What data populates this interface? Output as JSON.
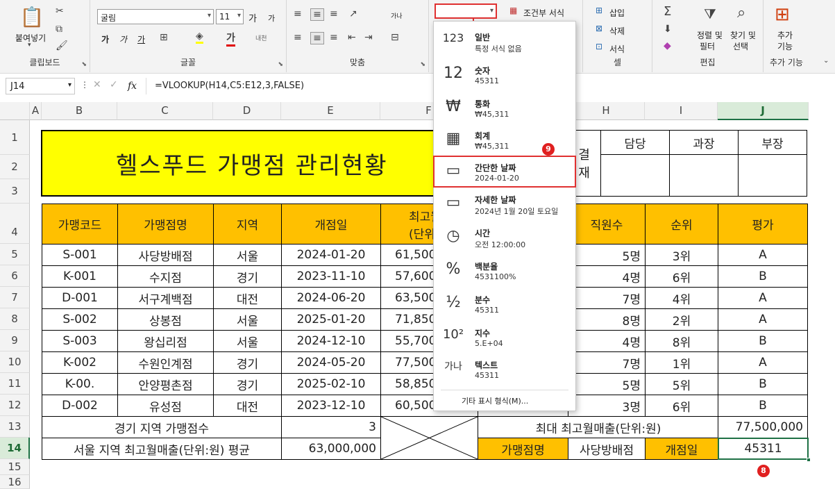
{
  "ribbon": {
    "clipboard": {
      "paste": "붙여넣기",
      "label": "클립보드"
    },
    "font": {
      "name": "굴림",
      "size": "11",
      "grow": "가",
      "shrink": "가",
      "bold": "가",
      "italic": "가",
      "underline": "가",
      "label": "글꼴",
      "phonetic": "내천"
    },
    "align": {
      "label": "맞춤",
      "wrap": "가나"
    },
    "number": {
      "format_value": "",
      "cond_format": "조건부 서식"
    },
    "cells": {
      "insert": "삽입",
      "delete": "삭제",
      "format": "서식",
      "label": "셀"
    },
    "editing": {
      "sort": "정렬 및",
      "sort2": "필터",
      "find": "찾기 및",
      "find2": "선택",
      "label": "편집"
    },
    "addins": {
      "label1": "추가",
      "label2": "기능",
      "group": "추가 기능"
    }
  },
  "formula_bar": {
    "name_box": "J14",
    "fx": "fx",
    "formula": "=VLOOKUP(H14,C5:E12,3,FALSE)"
  },
  "columns": [
    "A",
    "B",
    "C",
    "D",
    "E",
    "F",
    "G",
    "H",
    "I",
    "J"
  ],
  "rows": [
    "1",
    "2",
    "3",
    "4",
    "5",
    "6",
    "7",
    "8",
    "9",
    "10",
    "11",
    "12",
    "13",
    "14",
    "15",
    "16"
  ],
  "sheet": {
    "title": "헬스푸드 가맹점 관리현황",
    "approval": {
      "label1": "결",
      "label2": "재",
      "headers": [
        "담당",
        "과장",
        "부장"
      ]
    },
    "headers": [
      "가맹코드",
      "가맹점명",
      "지역",
      "개점일",
      "최고월",
      "(단위",
      "직원수",
      "순위",
      "평가"
    ],
    "table": [
      {
        "code": "S-001",
        "name": "사당방배점",
        "region": "서울",
        "date": "2024-01-20",
        "sales": "61,500",
        "staff": "5명",
        "rank": "3위",
        "grade": "A"
      },
      {
        "code": "K-001",
        "name": "수지점",
        "region": "경기",
        "date": "2023-11-10",
        "sales": "57,600",
        "staff": "4명",
        "rank": "6위",
        "grade": "B"
      },
      {
        "code": "D-001",
        "name": "서구계백점",
        "region": "대전",
        "date": "2024-06-20",
        "sales": "63,500",
        "staff": "7명",
        "rank": "4위",
        "grade": "A"
      },
      {
        "code": "S-002",
        "name": "상봉점",
        "region": "서울",
        "date": "2025-01-20",
        "sales": "71,850",
        "staff": "8명",
        "rank": "2위",
        "grade": "A"
      },
      {
        "code": "S-003",
        "name": "왕십리점",
        "region": "서울",
        "date": "2024-12-10",
        "sales": "55,700",
        "staff": "4명",
        "rank": "8위",
        "grade": "B"
      },
      {
        "code": "K-002",
        "name": "수원인계점",
        "region": "경기",
        "date": "2024-05-20",
        "sales": "77,500",
        "staff": "7명",
        "rank": "1위",
        "grade": "A"
      },
      {
        "code": "K-00.",
        "name": "안양평촌점",
        "region": "경기",
        "date": "2025-02-10",
        "sales": "58,850",
        "staff": "5명",
        "rank": "5위",
        "grade": "B"
      },
      {
        "code": "D-002",
        "name": "유성점",
        "region": "대전",
        "date": "2023-12-10",
        "sales": "60,500",
        "staff": "3명",
        "rank": "6위",
        "grade": "B"
      }
    ],
    "row13": {
      "label": "경기 지역 가맹점수",
      "value": "3",
      "label2": "최대 최고월매출(단위:원)",
      "value2": "77,500,000"
    },
    "row14": {
      "label": "서울 지역 최고월매출(단위:원) 평균",
      "value": "63,000,000",
      "h": "가맹점명",
      "i": "사당방배점",
      "j_label": "개점일",
      "result": "45311"
    }
  },
  "dropdown": {
    "items": [
      {
        "name": "일반",
        "sub": "특정 서식 없음",
        "icon": "123"
      },
      {
        "name": "숫자",
        "sub": "45311",
        "icon": "12"
      },
      {
        "name": "통화",
        "sub": "₩45,311",
        "icon": "₩"
      },
      {
        "name": "회계",
        "sub": " ₩45,311",
        "icon": "▦"
      },
      {
        "name": "간단한 날짜",
        "sub": "2024-01-20",
        "icon": "▭"
      },
      {
        "name": "자세한 날짜",
        "sub": "2024년 1월 20일 토요일",
        "icon": "▭"
      },
      {
        "name": "시간",
        "sub": "오전 12:00:00",
        "icon": "◷"
      },
      {
        "name": "백분율",
        "sub": "4531100%",
        "icon": "%"
      },
      {
        "name": "분수",
        "sub": "45311",
        "icon": "½"
      },
      {
        "name": "지수",
        "sub": "5.E+04",
        "icon": "10²"
      },
      {
        "name": "텍스트",
        "sub": "45311",
        "icon": "가나"
      }
    ],
    "more": "기타 표시 형식(M)..."
  },
  "badges": {
    "b8": "8",
    "b9": "9"
  },
  "colors": {
    "header_fill": "#ffc000",
    "title_fill": "#ffff00",
    "highlight": "#e03030",
    "selection": "#1e7145"
  }
}
